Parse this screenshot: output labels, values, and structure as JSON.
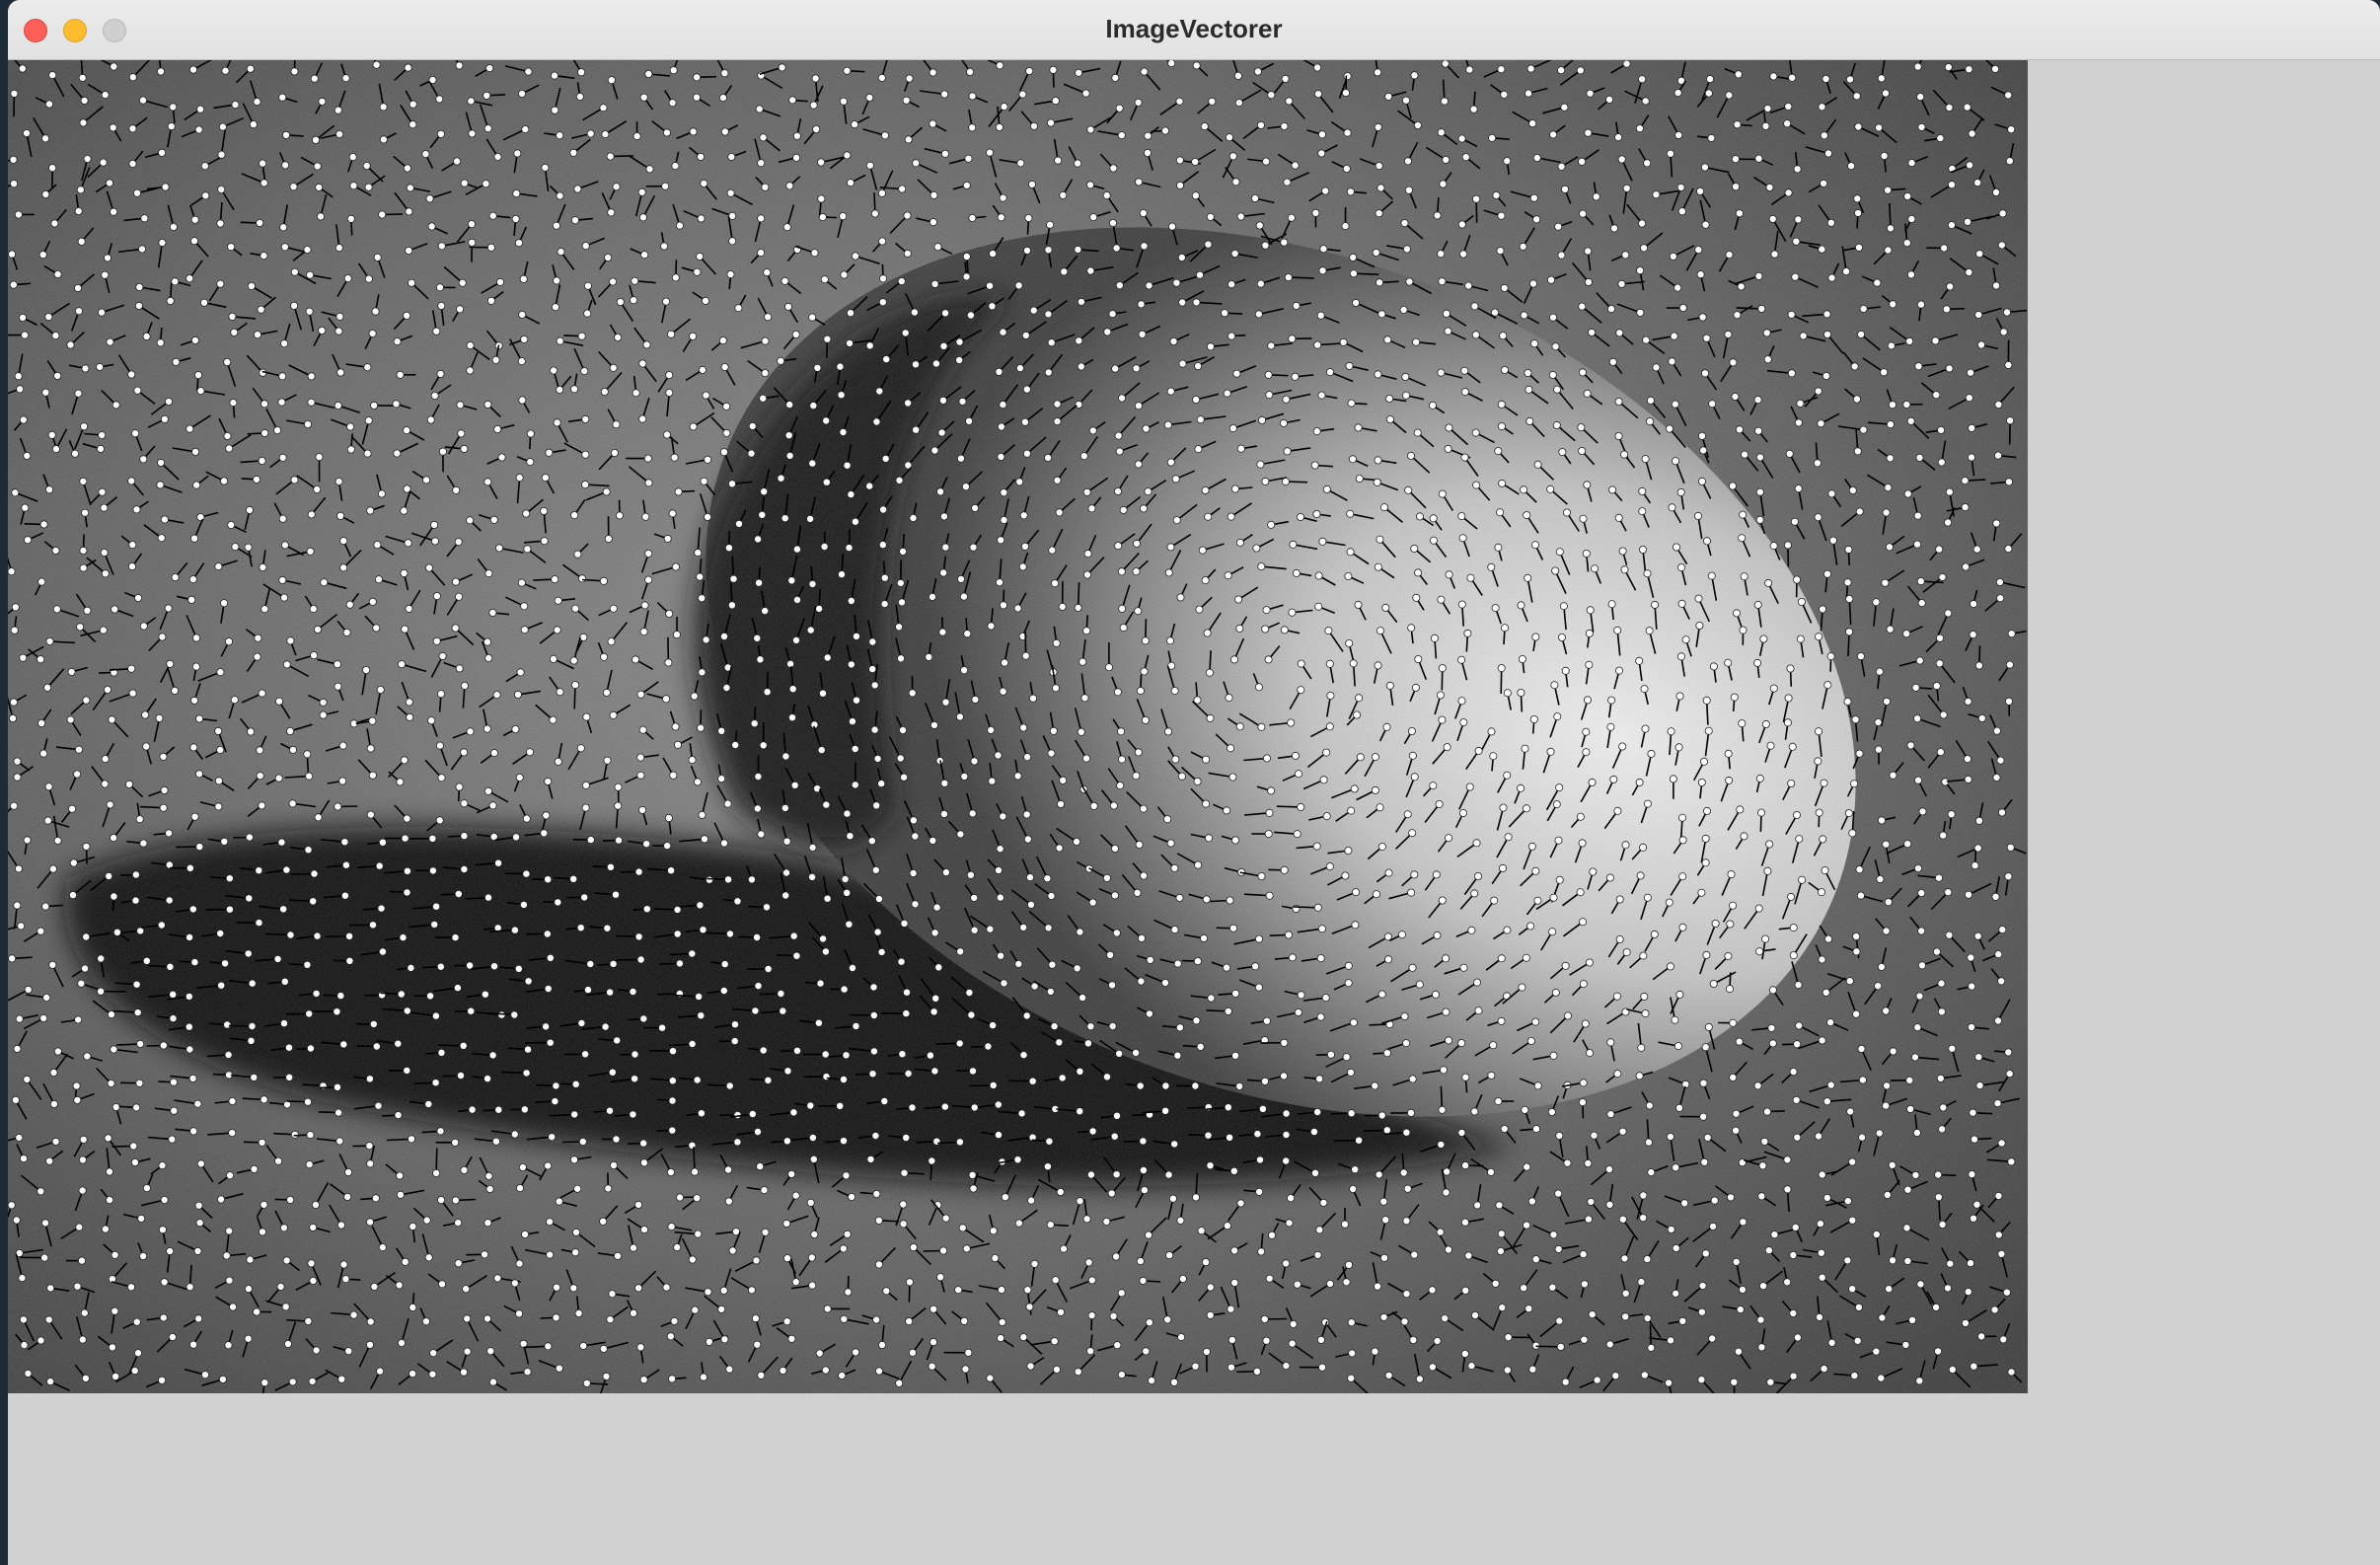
{
  "window": {
    "title": "ImageVectorer",
    "buttons": {
      "close": "close-button",
      "minimize": "minimize-button",
      "zoom": "zoom-button"
    }
  },
  "canvas": {
    "content": "vector-field-overlay",
    "colors": {
      "background_dark": "#1a1a1a",
      "background_mid": "#6f6f6f",
      "egg_highlight": "#e6e6e6",
      "vector_line": "#000000",
      "vector_dot": "#ffffff"
    }
  }
}
